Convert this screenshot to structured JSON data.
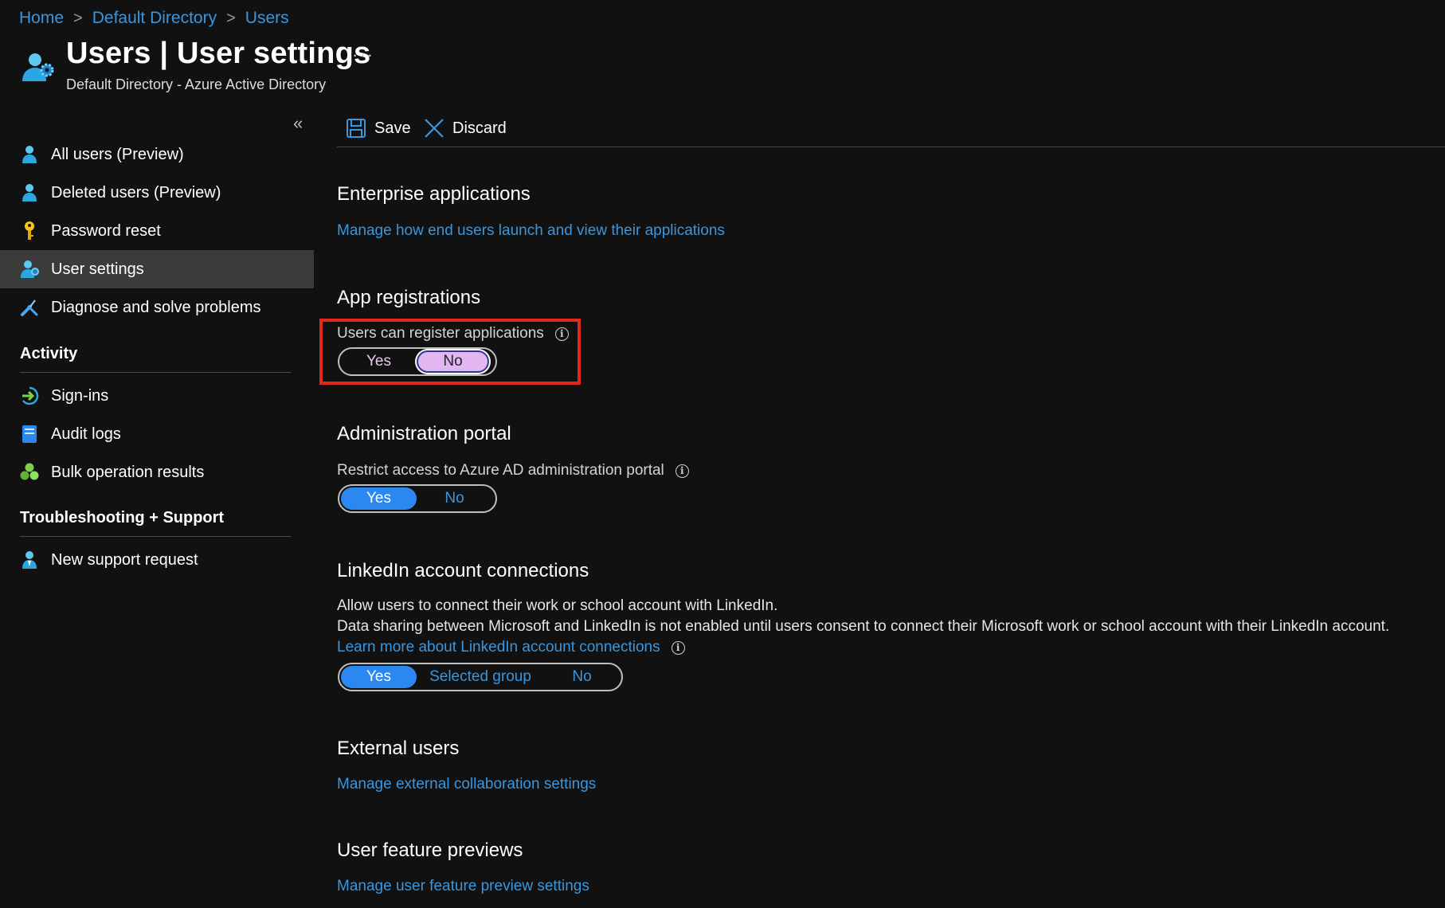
{
  "breadcrumb": {
    "home": "Home",
    "directory": "Default Directory",
    "users": "Users",
    "sep": ">"
  },
  "header": {
    "title": "Users | User settings",
    "subtitle": "Default Directory - Azure Active Directory",
    "more": "···",
    "icon": "users-gear-icon"
  },
  "sidebar": {
    "collapse": "«",
    "items": [
      {
        "label": "All users (Preview)",
        "icon": "user-icon"
      },
      {
        "label": "Deleted users (Preview)",
        "icon": "user-icon"
      },
      {
        "label": "Password reset",
        "icon": "key-icon"
      },
      {
        "label": "User settings",
        "icon": "user-settings-icon",
        "selected": true
      },
      {
        "label": "Diagnose and solve problems",
        "icon": "wrench-icon"
      }
    ],
    "activity": {
      "title": "Activity",
      "items": [
        {
          "label": "Sign-ins",
          "icon": "sign-in-icon"
        },
        {
          "label": "Audit logs",
          "icon": "audit-log-icon"
        },
        {
          "label": "Bulk operation results",
          "icon": "bulk-operation-icon"
        }
      ]
    },
    "support": {
      "title": "Troubleshooting + Support",
      "items": [
        {
          "label": "New support request",
          "icon": "support-user-icon"
        }
      ]
    }
  },
  "toolbar": {
    "save_label": "Save",
    "discard_label": "Discard"
  },
  "main": {
    "enterprise": {
      "title": "Enterprise applications",
      "link": "Manage how end users launch and view their applications"
    },
    "app_registrations": {
      "title": "App registrations",
      "setting_label": "Users can register applications",
      "options": [
        "Yes",
        "No"
      ],
      "selected": "No"
    },
    "admin_portal": {
      "title": "Administration portal",
      "setting_label": "Restrict access to Azure AD administration portal",
      "options": [
        "Yes",
        "No"
      ],
      "selected": "Yes"
    },
    "linkedin": {
      "title": "LinkedIn account connections",
      "desc1": "Allow users to connect their work or school account with LinkedIn.",
      "desc2": "Data sharing between Microsoft and LinkedIn is not enabled until users consent to connect their Microsoft work or school account with their LinkedIn account.",
      "learn_more": "Learn more about LinkedIn account connections",
      "options": [
        "Yes",
        "Selected group",
        "No"
      ],
      "selected": "Yes"
    },
    "external": {
      "title": "External users",
      "link": "Manage external collaboration settings"
    },
    "previews": {
      "title": "User feature previews",
      "link": "Manage user feature preview settings"
    },
    "info_glyph": "i"
  },
  "colors": {
    "background": "#111111",
    "link": "#3a96dd",
    "toggle_on": "#2b88f0",
    "highlight": "#e3271c",
    "selected_nav": "#3b3b3b"
  }
}
